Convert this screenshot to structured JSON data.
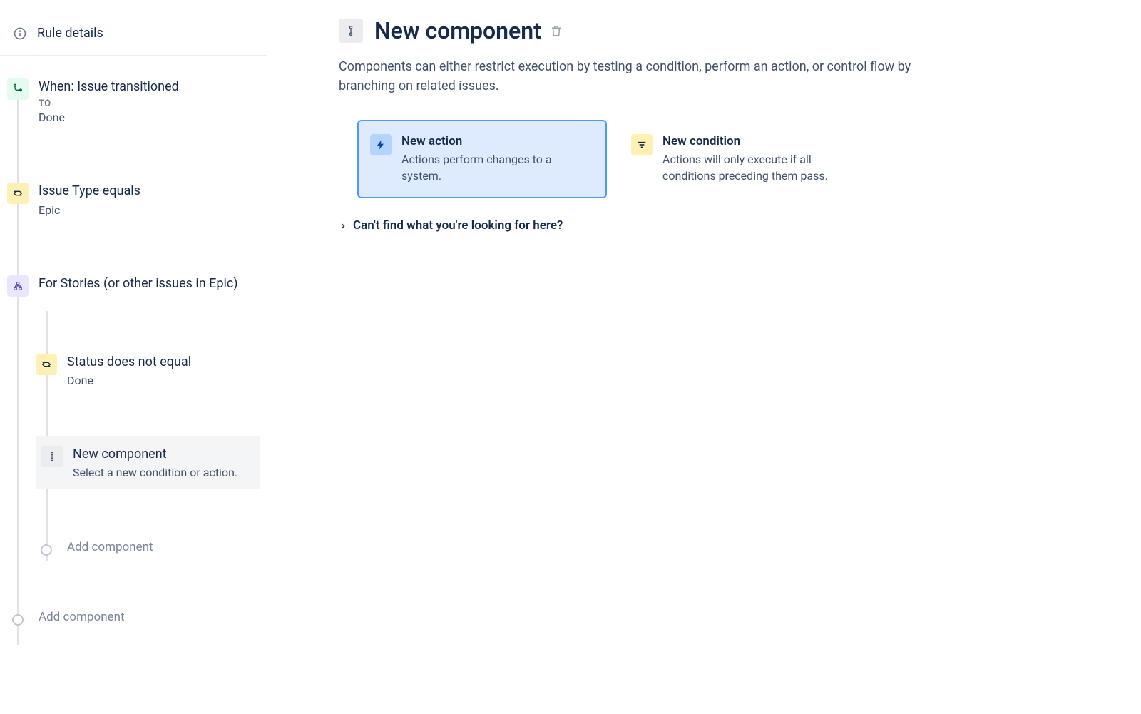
{
  "sidebar": {
    "header_label": "Rule details",
    "items": [
      {
        "title": "When: Issue transitioned",
        "sub_label": "TO",
        "sub": "Done"
      },
      {
        "title": "Issue Type equals",
        "sub": "Epic"
      },
      {
        "title": "For Stories (or other issues in Epic)"
      }
    ],
    "nested": [
      {
        "title": "Status does not equal",
        "sub": "Done"
      },
      {
        "title": "New component",
        "sub": "Select a new condition or action."
      }
    ],
    "add_inner": "Add component",
    "add_outer": "Add component"
  },
  "main": {
    "title": "New component",
    "description": "Components can either restrict execution by testing a condition, perform an action, or control flow by branching on related issues.",
    "cards": {
      "action": {
        "title": "New action",
        "desc": "Actions perform changes to a system."
      },
      "condition": {
        "title": "New condition",
        "desc": "Actions will only execute if all conditions preceding them pass."
      }
    },
    "expand_link": "Can't find what you're looking for here?"
  }
}
